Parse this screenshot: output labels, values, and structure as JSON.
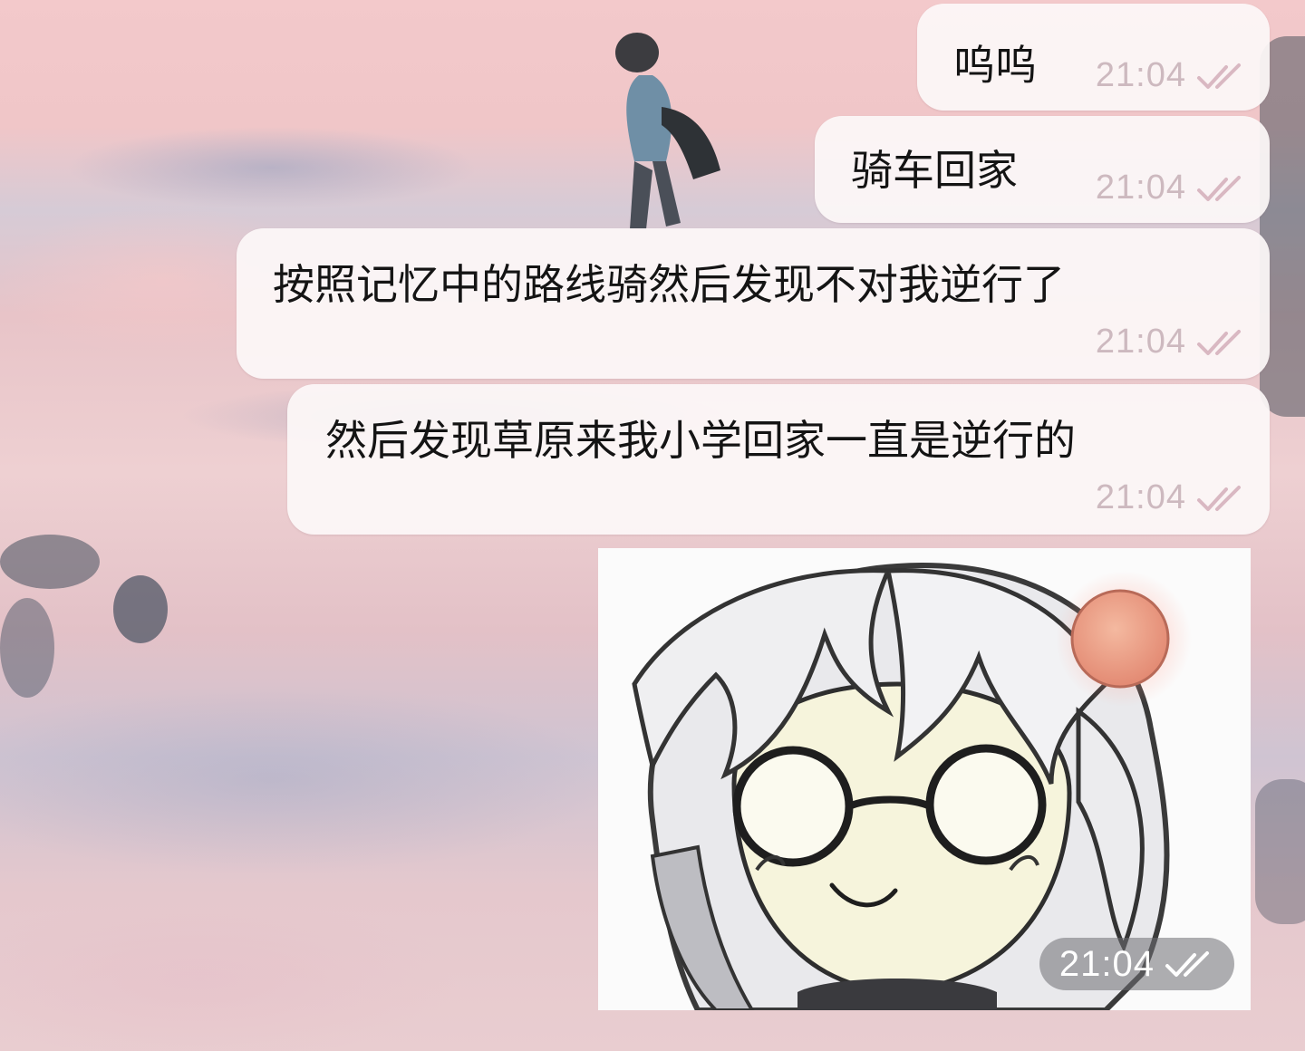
{
  "chat": {
    "messages": [
      {
        "type": "text",
        "text": "呜呜",
        "time": "21:04",
        "status": "read"
      },
      {
        "type": "text",
        "text": "骑车回家",
        "time": "21:04",
        "status": "read"
      },
      {
        "type": "text",
        "text": "按照记忆中的路线骑然后发现不对我逆行了",
        "time": "21:04",
        "status": "read"
      },
      {
        "type": "text",
        "text": "然后发现草原来我小学回家一直是逆行的",
        "time": "21:04",
        "status": "read"
      },
      {
        "type": "sticker",
        "icon": "anime-girl-with-glasses-sticker",
        "time": "21:04",
        "status": "read"
      }
    ]
  },
  "icons": {
    "read_receipt": "double-check-icon"
  },
  "colors": {
    "bubble_bg": "#fcf7f8",
    "time_text": "#cdb9bf",
    "check_in_bubble": "#d9b8c2",
    "check_on_sticker": "#ffffff",
    "wallpaper_pink": "#f0c6c8"
  }
}
